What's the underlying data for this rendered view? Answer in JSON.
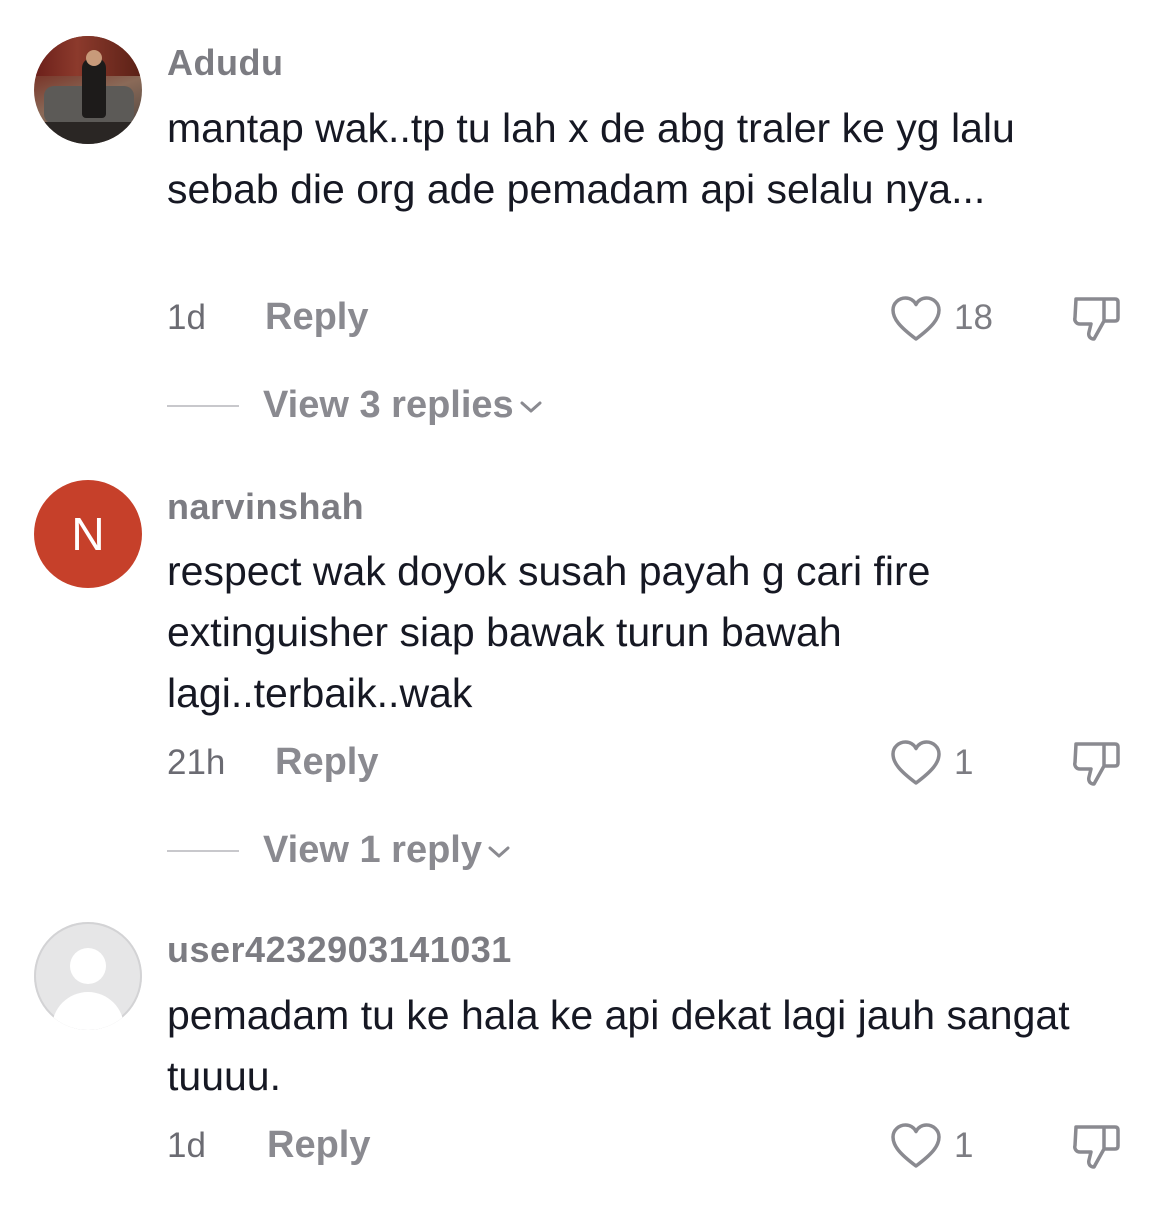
{
  "comments": [
    {
      "username": "Adudu",
      "avatar": "photo-avatar",
      "text": "mantap wak..tp tu lah x de abg traler ke yg lalu sebab die org ade pemadam api selalu nya...",
      "time": "1d",
      "reply_label": "Reply",
      "likes": "18",
      "view_replies": "View 3 replies"
    },
    {
      "username": "narvinshah",
      "avatar_letter": "N",
      "avatar_color": "#c6402a",
      "text": "respect wak doyok susah payah g cari fire extinguisher siap bawak turun bawah lagi..terbaik..wak",
      "time": "21h",
      "reply_label": "Reply",
      "likes": "1",
      "view_replies": "View 1 reply"
    },
    {
      "username": "user4232903141031",
      "avatar": "default-avatar",
      "text": "pemadam tu ke hala ke api dekat lagi jauh sangat tuuuu.",
      "time": "1d",
      "reply_label": "Reply",
      "likes": "1"
    }
  ]
}
